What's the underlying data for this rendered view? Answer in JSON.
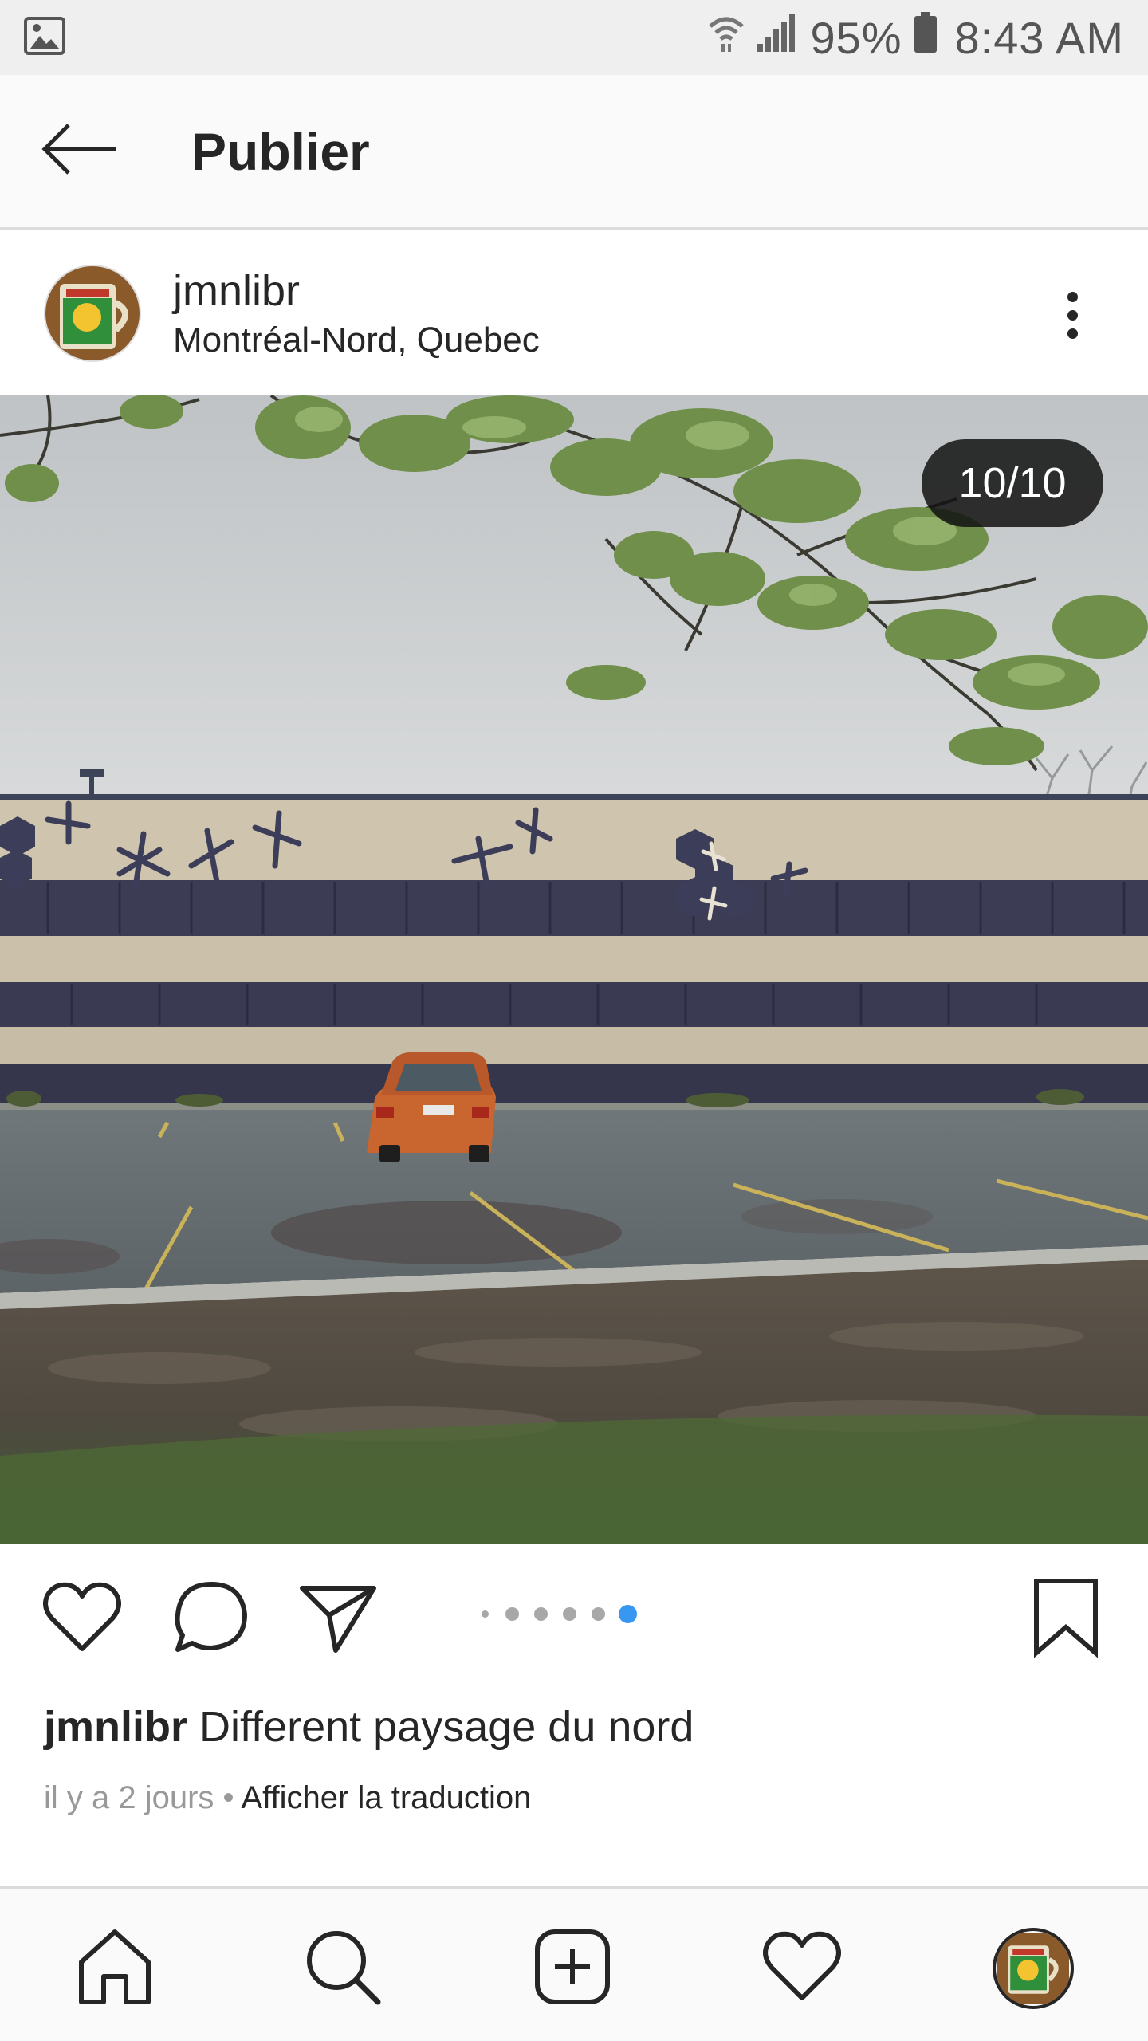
{
  "status_bar": {
    "battery_percent": "95%",
    "time": "8:43 AM",
    "icons": [
      "gallery-icon",
      "wifi-icon",
      "signal-icon",
      "battery-icon"
    ]
  },
  "header": {
    "title": "Publier",
    "back_icon": "arrow-left-icon"
  },
  "post": {
    "username": "jmnlibr",
    "location": "Montréal-Nord, Quebec",
    "counter": "10/10",
    "caption_user": "jmnlibr",
    "caption_text": "Different paysage du nord",
    "time_ago": "il y a 2 jours",
    "separator": "•",
    "translate_link": "Afficher la traduction",
    "carousel": {
      "total_visible_dots": 6,
      "active_index": 5
    }
  },
  "action_icons": [
    "heart-icon",
    "comment-icon",
    "share-icon",
    "bookmark-icon"
  ],
  "bottom_nav": {
    "items": [
      "home-icon",
      "search-icon",
      "add-post-icon",
      "activity-heart-icon",
      "profile-avatar"
    ]
  },
  "colors": {
    "accent_blue": "#3897f0",
    "text": "#262626",
    "muted": "#999999"
  }
}
